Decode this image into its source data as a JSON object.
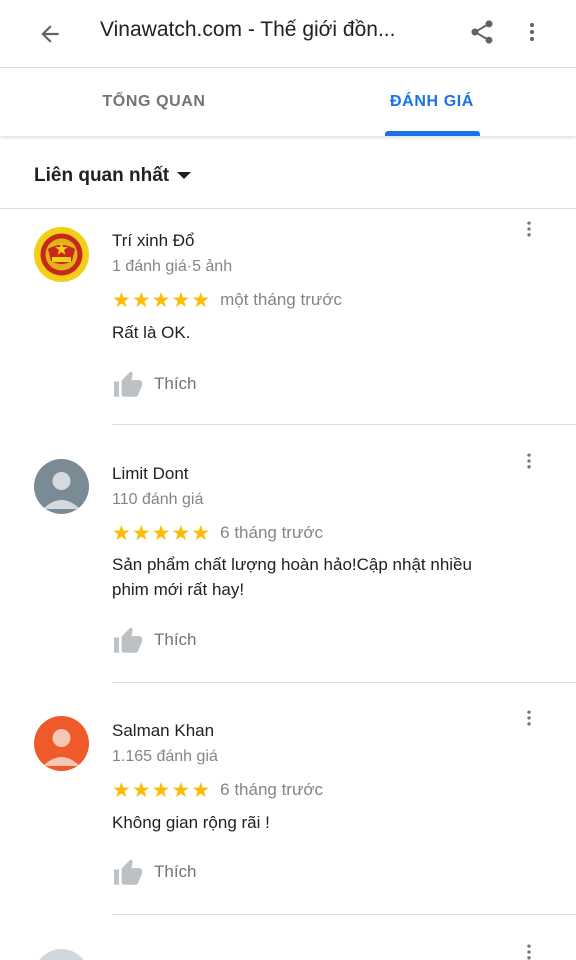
{
  "appbar": {
    "title": "Vinawatch.com - Thế giới đồn...",
    "back_icon": "arrow-back-icon",
    "share_icon": "share-icon",
    "more_icon": "more-vert-icon"
  },
  "tabs": [
    {
      "label": "TỔNG QUAN",
      "active": false
    },
    {
      "label": "ĐÁNH GIÁ",
      "active": true
    }
  ],
  "sort": {
    "label": "Liên quan nhất",
    "icon": "dropdown-arrow-icon"
  },
  "colors": {
    "accent": "#1a73e8",
    "star": "#fbbc04",
    "secondary_text": "#80868b"
  },
  "reviews": [
    {
      "name": "Trí xinh Đổ",
      "meta": "1 đánh giá·5 ảnh",
      "rating": 5,
      "date": "một tháng trước",
      "text": "Rất là OK.",
      "like_label": "Thích",
      "avatar": "emblem-avatar"
    },
    {
      "name": "Limit Dont",
      "meta": "110 đánh giá",
      "rating": 5,
      "date": "6 tháng trước",
      "text": "Sản phẩm chất lượng hoàn hảo!Cập nhật nhiều phim mới rất hay!",
      "like_label": "Thích",
      "avatar": "default-avatar-gray"
    },
    {
      "name": "Salman Khan",
      "meta": "1.165 đánh giá",
      "rating": 5,
      "date": "6 tháng trước",
      "text": "Không gian rộng rãi !",
      "like_label": "Thích",
      "avatar": "default-avatar-orange"
    }
  ]
}
